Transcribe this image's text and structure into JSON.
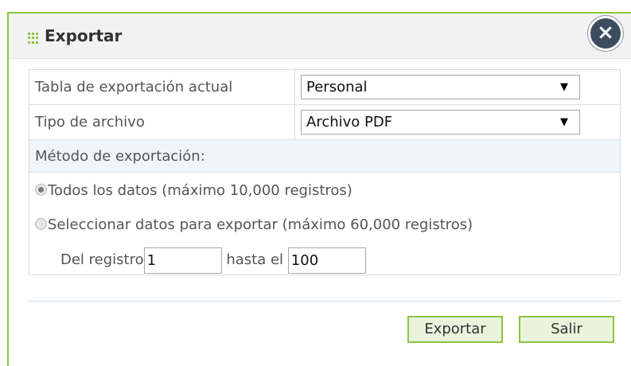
{
  "dialog": {
    "title": "Exportar",
    "close_label": "×"
  },
  "form": {
    "table_label": "Tabla de exportación actual",
    "table_value": "Personal",
    "filetype_label": "Tipo de archivo",
    "filetype_value": "Archivo PDF",
    "method_label": "Método de exportación:",
    "option_all": "Todos los datos (máximo 10,000 registros)",
    "option_select": "Seleccionar datos para exportar (máximo 60,000 registros)",
    "selected_option": "option_all",
    "range_from_label": "Del registro",
    "range_from_value": "1",
    "range_to_label": "hasta el",
    "range_to_value": "100"
  },
  "buttons": {
    "export": "Exportar",
    "exit": "Salir"
  },
  "colors": {
    "accent": "#8cc63f",
    "title_bg": "#f2f2f2",
    "section_bg": "#eef6fb",
    "close_bg": "#3d4d5f"
  },
  "icons": {
    "title": "grip-icon",
    "close": "close-icon",
    "dropdown": "dropdown-arrow-icon"
  }
}
